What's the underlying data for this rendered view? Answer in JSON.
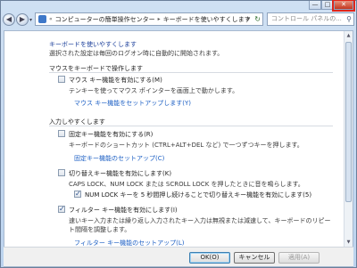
{
  "window": {
    "buttons": {
      "minimize": "—",
      "maximize": "□",
      "close": "✕"
    }
  },
  "nav": {
    "back": "◀",
    "forward": "▶",
    "breadcrumb_prefix": "«",
    "breadcrumb_1": "コンピューターの簡単操作センター",
    "breadcrumb_sep": "▸",
    "breadcrumb_2": "キーボードを使いやすくします",
    "search_placeholder": "コントロール パネルの..."
  },
  "content": {
    "title": "キーボードを使いやすくします",
    "subtitle": "選択された設定は毎回のログオン時に自動的に開始されます。",
    "section1": "マウスをキーボードで操作します",
    "mousekeys_label": "マウス キー機能を有効にする(M)",
    "mousekeys_desc": "テンキーを使ってマウス ポインターを画面上で動かします。",
    "mousekeys_link": "マウス キー機能をセットアップします(Y)",
    "section2": "入力しやすくします",
    "sticky_label": "固定キー機能を有効にする(R)",
    "sticky_desc": "キーボードのショートカット (CTRL+ALT+DEL など) で一つずつキーを押します。",
    "sticky_link": "固定キー機能のセットアップ(C)",
    "toggle_label": "切り替えキー機能を有効にします(K)",
    "toggle_desc": "CAPS LOCK、NUM LOCK または SCROLL LOCK を押したときに音を鳴らします。",
    "numlock_label": "NUM LOCK キーを 5 秒間押し続けることで切り替えキー機能を有効にします(5)",
    "filter_label": "フィルター キー機能を有効にします(I)",
    "filter_desc": "速いキー入力または繰り返し入力されたキー入力は無視または減速して、キーボードのリピート間隔を調整します。",
    "filter_link": "フィルター キー機能のセットアップ(L)"
  },
  "state": {
    "mousekeys_checked": false,
    "sticky_checked": false,
    "toggle_checked": false,
    "numlock_checked": true,
    "filter_checked": true
  },
  "footer": {
    "ok": "OK(O)",
    "cancel": "キャンセル",
    "apply": "適用(A)"
  }
}
